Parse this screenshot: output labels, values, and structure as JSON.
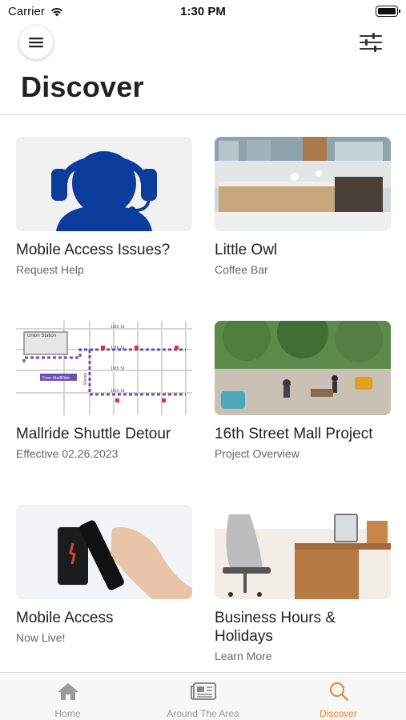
{
  "status_bar": {
    "carrier": "Carrier",
    "time": "1:30 PM"
  },
  "header": {
    "title": "Discover",
    "menu_icon": "hamburger-menu-icon",
    "filter_icon": "sliders-filter-icon"
  },
  "cards": [
    {
      "title": "Mobile Access Issues?",
      "subtitle": "Request Help",
      "image": "support-headset-image"
    },
    {
      "title": "Little Owl",
      "subtitle": "Coffee Bar",
      "image": "coffee-bar-photo"
    },
    {
      "title": "Mallride Shuttle Detour",
      "subtitle": "Effective 02.26.2023",
      "image": "detour-map-image",
      "map_labels": {
        "union_station": "Union Station",
        "free_mallride": "Free MallRide",
        "street_1": "18th St",
        "street_2": "17th St",
        "street_3": "16th St",
        "street_4": "15th St",
        "wazee": "Wazee"
      }
    },
    {
      "title": "16th Street Mall Project",
      "subtitle": "Project Overview",
      "image": "street-mall-photo"
    },
    {
      "title": "Mobile Access",
      "subtitle": "Now Live!",
      "image": "phone-reader-photo"
    },
    {
      "title": "Business Hours & Holidays",
      "subtitle": "Learn More",
      "image": "office-desk-photo"
    }
  ],
  "tab_bar": {
    "tabs": [
      {
        "label": "Home",
        "icon": "home-icon",
        "active": false
      },
      {
        "label": "Around The Area",
        "icon": "newspaper-icon",
        "active": false
      },
      {
        "label": "Discover",
        "icon": "search-icon",
        "active": true
      }
    ]
  },
  "colors": {
    "accent": "#e8862a",
    "inactive": "#999999",
    "support_blue": "#0b3c9c"
  }
}
